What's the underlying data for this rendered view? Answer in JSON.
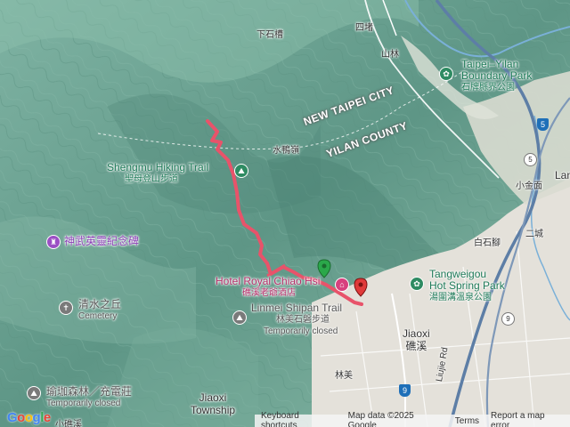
{
  "colors": {
    "terrain": "#6fa596",
    "urban": "#e4e1da",
    "route": "#e8536a",
    "water": "#7ab0d8",
    "highway": "#1e6fb8"
  },
  "routes": [
    "下石槽",
    "四堵",
    "山林",
    "水鴨嶺",
    "白石腳",
    "二城",
    "小金面",
    "林美",
    "小礁溪",
    "Liujie Rd",
    "Lan"
  ],
  "counties": {
    "newtaipei": "NEW TAIPEI CITY",
    "yilan": "YILAN COUNTY"
  },
  "pois": {
    "boundary_park": {
      "en": "Taipei–Yilan",
      "en2": "Boundary Park",
      "zh": "石牌縣界公園"
    },
    "shengmu": {
      "en": "Shengmu Hiking Trail",
      "zh": "聖母登山步道"
    },
    "shenwu": {
      "zh": "神武英靈紀念碑"
    },
    "hotel": {
      "en": "Hotel Royal Chiao Hsi",
      "zh": "礁溪老爺酒店"
    },
    "tangweigou": {
      "en": "Tangweigou",
      "en2": "Hot Spring Park",
      "zh": "湯圍溝溫泉公園"
    },
    "qingshui": {
      "zh": "清水之丘",
      "en": "Cemetery"
    },
    "linmei": {
      "en": "Linmei Shipan Trail",
      "zh": "林美石磐步道",
      "status": "Temporarily closed"
    },
    "yuqie": {
      "zh": "瑜珈森林／充電莊",
      "status": "Temporarily closed"
    }
  },
  "towns": {
    "jiaoxi_en": "Jiaoxi",
    "jiaoxi_zh": "礁溪",
    "township": "Jiaoxi",
    "township2": "Township"
  },
  "highways": [
    "5",
    "5",
    "9",
    "9"
  ],
  "icons": [
    "park-icon",
    "hiking-icon",
    "memorial-icon",
    "hotel-icon",
    "cemetery-icon",
    "start-marker-icon",
    "end-marker-icon"
  ],
  "footer": {
    "shortcuts": "Keyboard shortcuts",
    "mapdata": "Map data ©2025 Google",
    "terms": "Terms",
    "report": "Report a map error"
  },
  "logo": {
    "google": "Google"
  }
}
